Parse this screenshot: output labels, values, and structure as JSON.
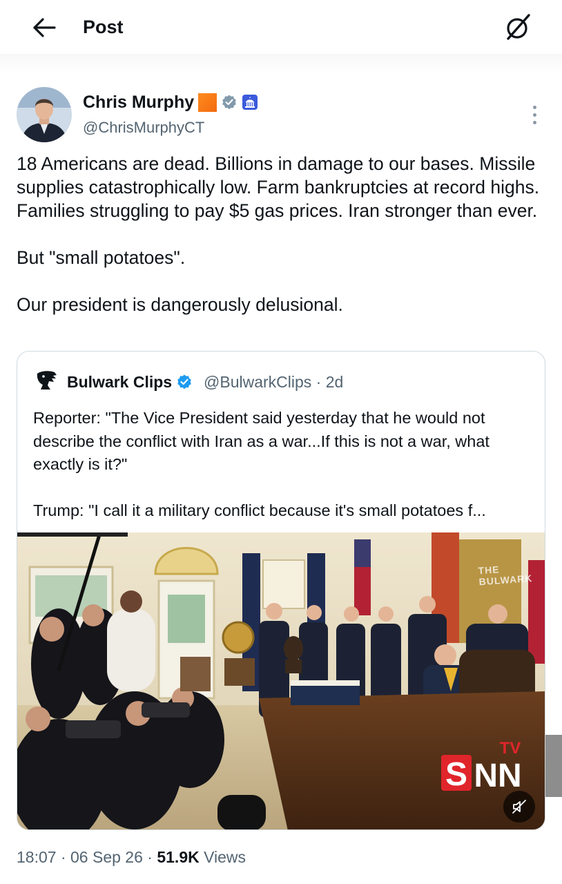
{
  "header": {
    "title": "Post",
    "back_icon": "arrow-left-icon",
    "grok_icon": "grok-icon"
  },
  "post": {
    "author": {
      "name": "Chris Murphy",
      "handle": "@ChrisMurphyCT",
      "badges": [
        "orange-square-icon",
        "verified-gray-icon",
        "government-badge-icon"
      ]
    },
    "paragraphs": [
      "18 Americans are dead. Billions in damage to our bases. Missile supplies catastrophically low. Farm bankruptcies at record highs. Families struggling to pay $5 gas prices. Iran stronger than ever.",
      "But \"small potatoes\".",
      "Our president is dangerously delusional."
    ],
    "time": "18:07",
    "date": "06 Sep 26",
    "views_count": "51.9K",
    "views_label": "Views",
    "separator": "·"
  },
  "quote": {
    "name": "Bulwark Clips",
    "handle": "@BulwarkClips",
    "age": "· 2d",
    "paragraphs": [
      "Reporter: \"The Vice President said yesterday that he would not describe the conflict with Iran as a war...If this is not a war, what exactly is it?\"",
      "Trump: \"I call it a military conflict because it's small potatoes f..."
    ],
    "media": {
      "watermark_text": "THE BULWARK",
      "channel_logo": "SNN",
      "channel_logo_sup": "TV",
      "mute_icon": "speaker-muted-icon"
    }
  },
  "colors": {
    "text": "#0f1419",
    "secondary": "#536471",
    "border": "#cfd9de",
    "verified_blue": "#1d9bf0",
    "snn_red": "#e0252b"
  }
}
